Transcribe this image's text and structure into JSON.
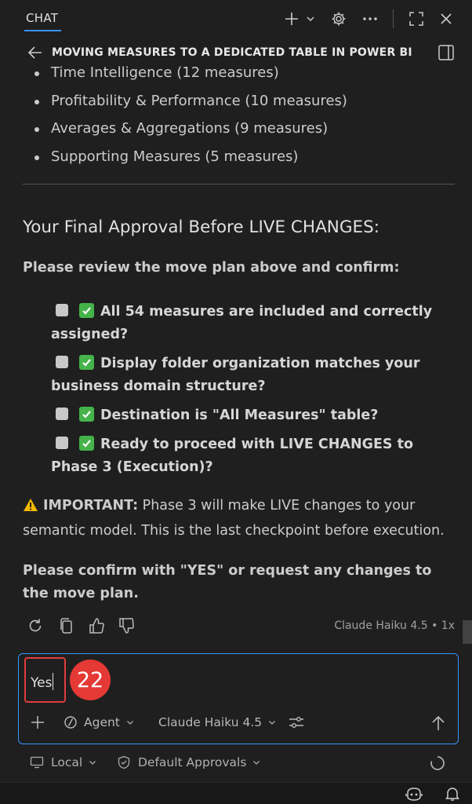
{
  "topbar": {
    "tab_label": "CHAT",
    "icons": [
      "plus-icon",
      "chevron-down-icon",
      "gear-icon",
      "ellipsis-icon",
      "maximize-icon",
      "close-icon"
    ]
  },
  "header": {
    "title": "MOVING MEASURES TO A DEDICATED TABLE IN POWER BI"
  },
  "bullets": [
    "Time Intelligence (12 measures)",
    "Profitability & Performance (10 measures)",
    "Averages & Aggregations (9 measures)",
    "Supporting Measures (5 measures)"
  ],
  "approval": {
    "title": "Your Final Approval Before LIVE CHANGES:",
    "intro": "Please review the move plan above and confirm:",
    "items": [
      "All 54 measures are included and correctly assigned?",
      "Display folder organization matches your business domain structure?",
      "Destination is \"All Measures\" table?",
      "Ready to proceed with LIVE CHANGES to Phase 3 (Execution)?"
    ],
    "important_label": "IMPORTANT:",
    "important_text": " Phase 3 will make LIVE changes to your semantic model. This is the last checkpoint before execution.",
    "confirm_text": "Please confirm with \"YES\" or request any changes to the move plan."
  },
  "message_actions": {
    "model_meta": "Claude Haiku 4.5 • 1x"
  },
  "input": {
    "value": "Yes",
    "annotation_number": "22",
    "mode_label": "Agent",
    "model_label": "Claude Haiku 4.5"
  },
  "bottom": {
    "location_label": "Local",
    "approvals_label": "Default Approvals"
  },
  "colors": {
    "accent": "#3794ff",
    "highlight": "#e03c3c",
    "check_green": "#44b34a",
    "warning": "#f5b800"
  }
}
